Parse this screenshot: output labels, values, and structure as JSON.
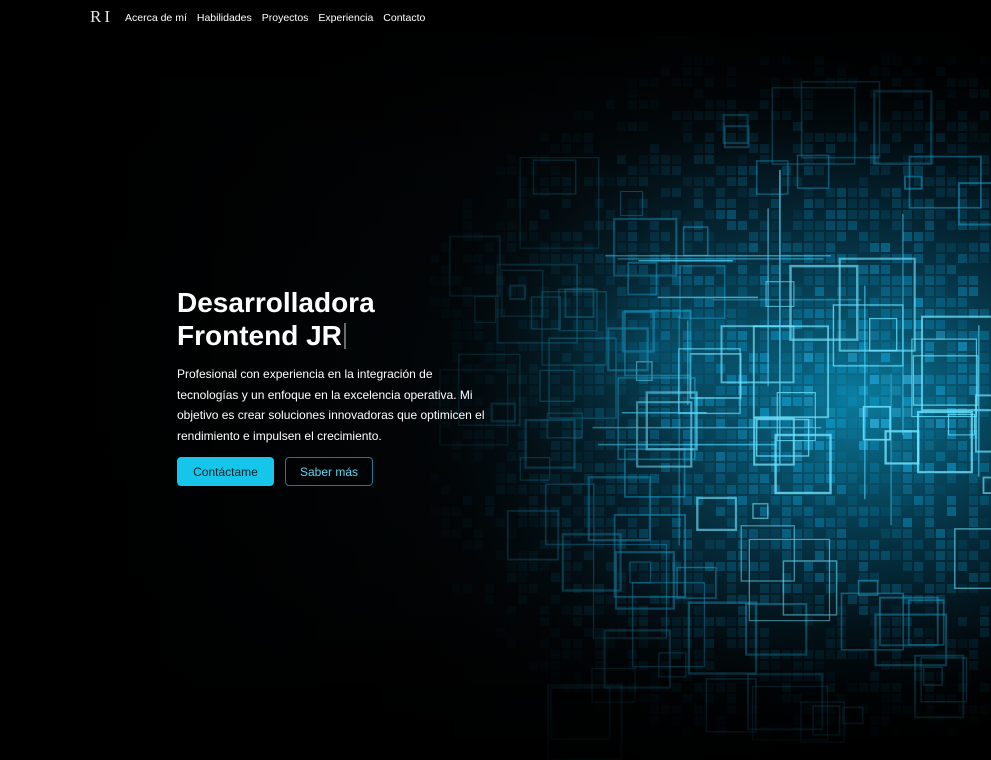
{
  "nav": {
    "logo": "RI",
    "links": [
      "Acerca de mí",
      "Habilidades",
      "Proyectos",
      "Experiencia",
      "Contacto"
    ]
  },
  "hero": {
    "title": "Desarrolladora Frontend JR",
    "description": "Profesional con experiencia en la integración de tecnologías y un enfoque en la excelencia operativa. Mi objetivo es crear soluciones innovadoras que optimicen el rendimiento e impulsen el crecimiento.",
    "primary_button": "Contáctame",
    "secondary_button": "Saber más",
    "background_image": "abstract-digital-grid"
  },
  "colors": {
    "accent": "#16c5ea",
    "background": "#000000",
    "text": "#ffffff"
  }
}
